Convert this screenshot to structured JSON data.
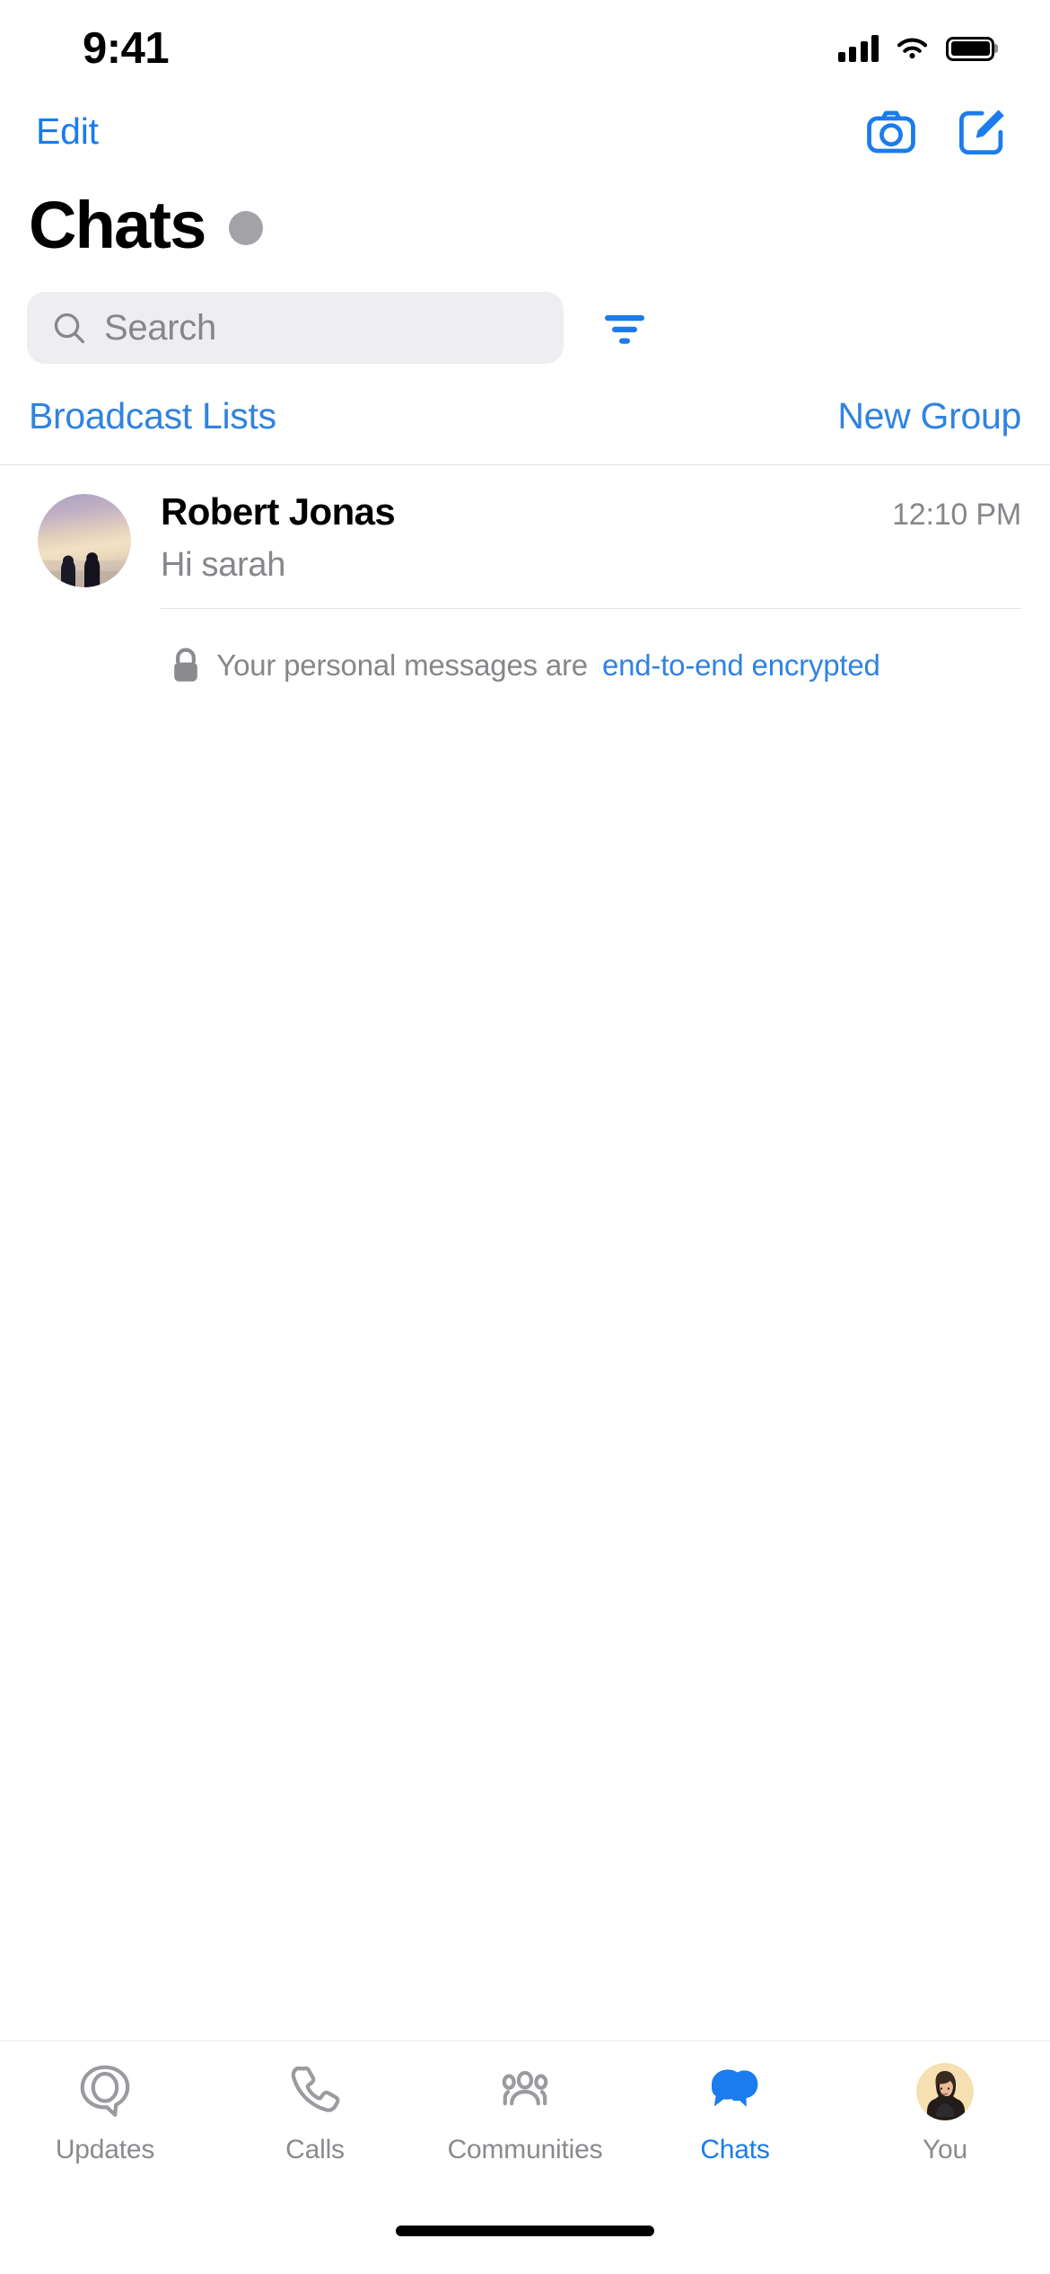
{
  "status_bar": {
    "time": "9:41",
    "signal_icon": "cellular-signal-icon",
    "wifi_icon": "wifi-icon",
    "battery_icon": "battery-full-icon"
  },
  "nav_bar": {
    "edit_label": "Edit",
    "camera_icon": "camera-icon",
    "compose_icon": "compose-icon"
  },
  "header": {
    "title": "Chats",
    "status_dot_color": "#a2a2a7"
  },
  "search": {
    "placeholder": "Search",
    "search_icon": "search-icon",
    "filter_icon": "filter-icon"
  },
  "quick_actions": {
    "broadcast_label": "Broadcast Lists",
    "new_group_label": "New Group"
  },
  "chats": [
    {
      "name": "Robert Jonas",
      "preview": "Hi sarah",
      "time": "12:10 PM",
      "avatar_alt": "sunset-silhouette-photo"
    }
  ],
  "encryption_notice": {
    "lock_icon": "lock-icon",
    "text": "Your personal messages are",
    "link": "end-to-end encrypted"
  },
  "tab_bar": {
    "items": [
      {
        "label": "Updates",
        "icon": "updates-status-icon",
        "active": false
      },
      {
        "label": "Calls",
        "icon": "phone-icon",
        "active": false
      },
      {
        "label": "Communities",
        "icon": "communities-people-icon",
        "active": false
      },
      {
        "label": "Chats",
        "icon": "chat-bubbles-icon",
        "active": true
      },
      {
        "label": "You",
        "icon": "profile-avatar-icon",
        "active": true
      }
    ]
  },
  "colors": {
    "accent_blue": "#1a7ced",
    "link_blue": "#3083e0",
    "secondary_text": "#86868b",
    "search_bg": "#eeeef1",
    "separator": "#e3e3e6"
  }
}
